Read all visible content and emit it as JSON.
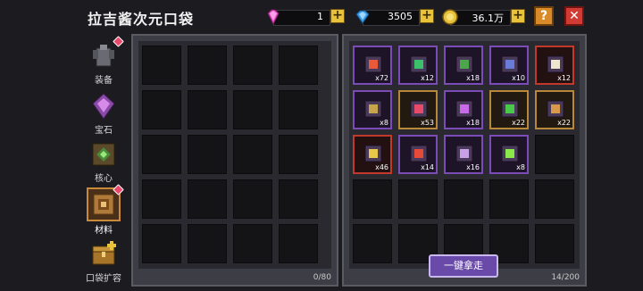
{
  "header": {
    "title": "拉吉酱次元口袋"
  },
  "resources": {
    "gem": {
      "value": "1"
    },
    "diamond": {
      "value": "3505"
    },
    "gold": {
      "value": "36.1万"
    }
  },
  "sidebar": {
    "items": [
      {
        "label": "装备",
        "icon": "armor-icon",
        "badge": true
      },
      {
        "label": "宝石",
        "icon": "gem-icon",
        "badge": false
      },
      {
        "label": "核心",
        "icon": "core-icon",
        "badge": false
      },
      {
        "label": "材料",
        "icon": "material-icon",
        "badge": true,
        "active": true
      },
      {
        "label": "口袋扩容",
        "icon": "chest-icon",
        "badge": false
      }
    ]
  },
  "left_panel": {
    "capacity": "0/80"
  },
  "right_panel": {
    "capacity": "14/200",
    "items": [
      {
        "count": "x72",
        "rarity": "rare",
        "color": "#e85a3a"
      },
      {
        "count": "x12",
        "rarity": "rare",
        "color": "#3bbf6a"
      },
      {
        "count": "x18",
        "rarity": "rare",
        "color": "#4aa84a"
      },
      {
        "count": "x10",
        "rarity": "rare",
        "color": "#6a7ad8"
      },
      {
        "count": "x12",
        "rarity": "leg",
        "color": "#f0e6d0"
      },
      {
        "count": "x8",
        "rarity": "rare",
        "color": "#c8a44a"
      },
      {
        "count": "x53",
        "rarity": "epic",
        "color": "#e84a6a"
      },
      {
        "count": "x18",
        "rarity": "rare",
        "color": "#c86ae8"
      },
      {
        "count": "x22",
        "rarity": "epic",
        "color": "#4ac84a"
      },
      {
        "count": "x22",
        "rarity": "epic",
        "color": "#d89a4a"
      },
      {
        "count": "x46",
        "rarity": "leg",
        "color": "#e8c84a"
      },
      {
        "count": "x14",
        "rarity": "rare",
        "color": "#e84a3a"
      },
      {
        "count": "x16",
        "rarity": "rare",
        "color": "#c8a0e8"
      },
      {
        "count": "x8",
        "rarity": "rare",
        "color": "#8ae84a"
      }
    ]
  },
  "actions": {
    "collect_all": "一键拿走"
  }
}
